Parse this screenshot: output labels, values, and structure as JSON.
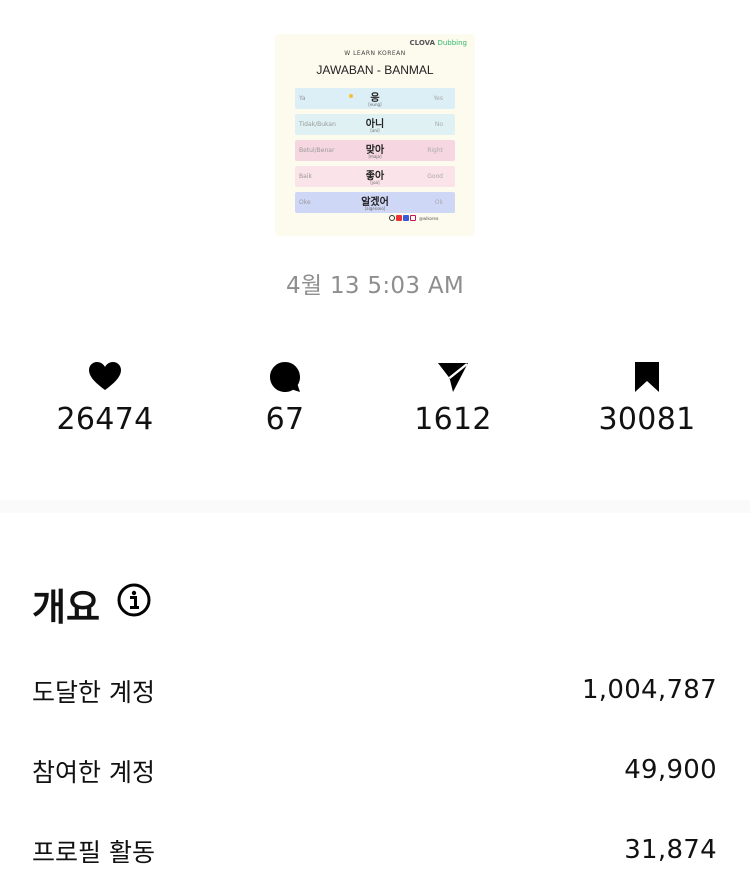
{
  "post": {
    "brand": "CLOVA",
    "brand_suffix": "Dubbing",
    "kicker": "W LEARN KOREAN",
    "title": "JAWABAN - BANMAL",
    "rows": [
      {
        "left": "Ya",
        "korean": "응",
        "pron": "[eung]",
        "right": "Yes",
        "color": "#dceef6"
      },
      {
        "left": "Tidak/Bukan",
        "korean": "아니",
        "pron": "[ani]",
        "right": "No",
        "color": "#dff1f3"
      },
      {
        "left": "Betul/Benar",
        "korean": "맞아",
        "pron": "[maja]",
        "right": "Right",
        "color": "#f6d7e1"
      },
      {
        "left": "Baik",
        "korean": "좋아",
        "pron": "[joa]",
        "right": "Good",
        "color": "#fbe3ea"
      },
      {
        "left": "Oke",
        "korean": "알겠어",
        "pron": "[algesseo]",
        "right": "Ok",
        "color": "#cfd7f6"
      }
    ],
    "handle": "@wlkorea"
  },
  "timestamp": "4월 13 5:03 AM",
  "stats": {
    "likes": "26474",
    "comments": "67",
    "shares": "1612",
    "saves": "30081"
  },
  "overview": {
    "title": "개요",
    "metrics": [
      {
        "label": "도달한 계정",
        "value": "1,004,787"
      },
      {
        "label": "참여한 계정",
        "value": "49,900"
      },
      {
        "label": "프로필 활동",
        "value": "31,874"
      }
    ]
  }
}
